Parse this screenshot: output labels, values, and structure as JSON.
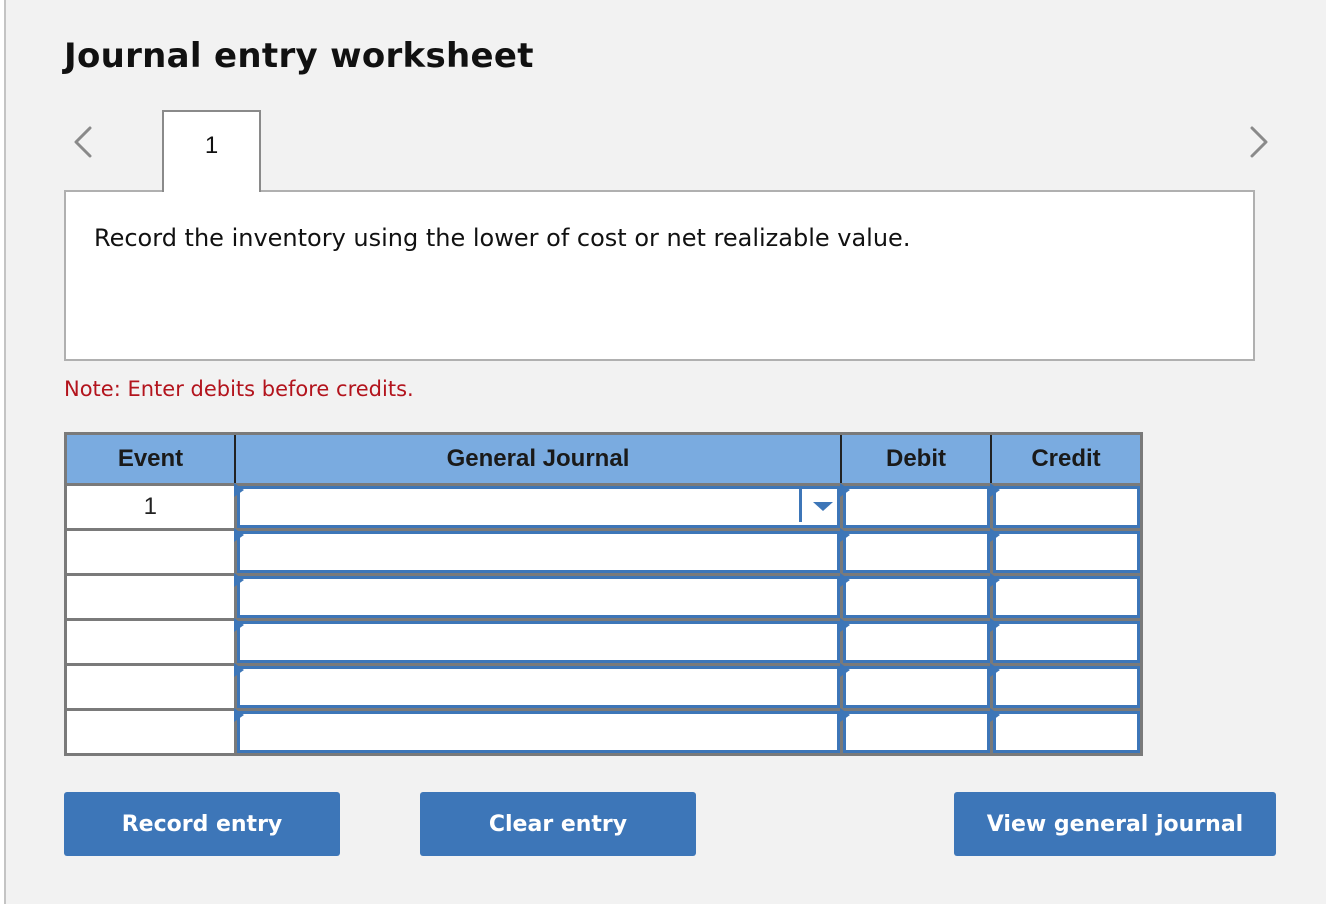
{
  "header": {
    "title": "Journal entry worksheet"
  },
  "navigation": {
    "prev_icon": "chevron-left-icon",
    "next_icon": "chevron-right-icon",
    "tabs": [
      {
        "label": "1",
        "active": true
      }
    ]
  },
  "prompt": {
    "text": "Record the inventory using the lower of cost or net realizable value."
  },
  "note": {
    "text": "Note: Enter debits before credits.",
    "color": "#b3141d"
  },
  "journal_table": {
    "columns": [
      "Event",
      "General Journal",
      "Debit",
      "Credit"
    ],
    "rows": [
      {
        "event": "1",
        "account": "",
        "debit": "",
        "credit": "",
        "has_dropdown": true
      },
      {
        "event": "",
        "account": "",
        "debit": "",
        "credit": ""
      },
      {
        "event": "",
        "account": "",
        "debit": "",
        "credit": ""
      },
      {
        "event": "",
        "account": "",
        "debit": "",
        "credit": ""
      },
      {
        "event": "",
        "account": "",
        "debit": "",
        "credit": ""
      },
      {
        "event": "",
        "account": "",
        "debit": "",
        "credit": ""
      }
    ],
    "header_color": "#7aabe0",
    "field_color": "#3d76b8"
  },
  "buttons": {
    "record_entry": "Record entry",
    "clear_entry": "Clear entry",
    "view_general_journal": "View general journal",
    "color": "#3d76b8"
  }
}
